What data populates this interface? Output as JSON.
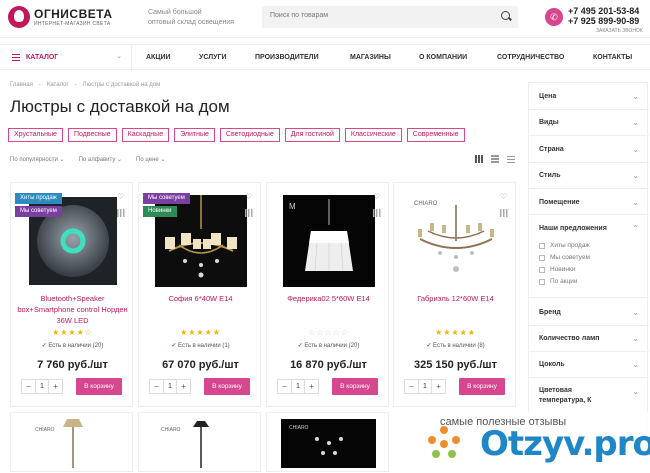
{
  "header": {
    "logo_name": "ОГНИСВЕТА",
    "logo_sub": "ИНТЕРНЕТ-МАГАЗИН СВЕТА",
    "tagline_1": "Самый большой",
    "tagline_2": "оптовый склад освещения",
    "search_placeholder": "Поиск по товарам",
    "phone_1": "+7 495 201-53-84",
    "phone_2": "+7 925 899-90-89",
    "callback": "ЗАКАЗАТЬ ЗВОНОК"
  },
  "nav": {
    "catalog": "КАТАЛОГ",
    "items": [
      "АКЦИИ",
      "УСЛУГИ",
      "ПРОИЗВОДИТЕЛИ",
      "МАГАЗИНЫ",
      "О КОМПАНИИ",
      "СОТРУДНИЧЕСТВО",
      "КОНТАКТЫ"
    ]
  },
  "breadcrumbs": [
    "Главная",
    "-",
    "Каталог",
    "-",
    "Люстры с доставкой на дом"
  ],
  "page_title": "Люстры с доставкой на дом",
  "chips": [
    "Хрустальные",
    "Подвесные",
    "Каскадные",
    "Элитные",
    "Светодиодные",
    "Для гостиной",
    "Классические",
    "Современные"
  ],
  "sort": [
    "По популярности ⌄",
    "По алфавиту ⌄",
    "По цене ⌄"
  ],
  "cart_label": "В корзину",
  "products": [
    {
      "name": "Bluetooth+Speaker box+Smartphone control Норден 36W LED",
      "badges": [
        "Хиты продаж",
        "Мы советуем"
      ],
      "stars": "★★★★☆",
      "stock": "Есть в наличии (20)",
      "price": "7 760 руб./шт",
      "qty": "1"
    },
    {
      "name": "София 6*40W E14",
      "badges": [
        "Мы советуем",
        "Новинки"
      ],
      "stars": "★★★★★",
      "stock": "Есть в наличии (1)",
      "price": "67 070 руб./шт",
      "qty": "1"
    },
    {
      "name": "Федерика02 5*60W E14",
      "badges": [],
      "stars": "☆☆☆☆☆",
      "stock": "Есть в наличии (20)",
      "price": "16 870 руб./шт",
      "qty": "1"
    },
    {
      "name": "Габриэль 12*60W E14",
      "badges": [],
      "stars": "★★★★★",
      "stock": "Есть в наличии (8)",
      "price": "325 150 руб./шт",
      "qty": "1"
    }
  ],
  "filters": {
    "groups": [
      "Цена",
      "Виды",
      "Страна",
      "Стиль",
      "Помещение",
      "Наши предложения",
      "Бренд",
      "Количество ламп",
      "Цоколь",
      "Цветовая температура, К"
    ],
    "offers": [
      "Хиты продаж",
      "Мы советуем",
      "Новинки",
      "По акции"
    ]
  },
  "watermark": {
    "text": "самые полезные отзывы",
    "logo": "Otzyv.pro"
  },
  "colors": {
    "accent": "#d6478f",
    "brand": "#c2185b"
  }
}
